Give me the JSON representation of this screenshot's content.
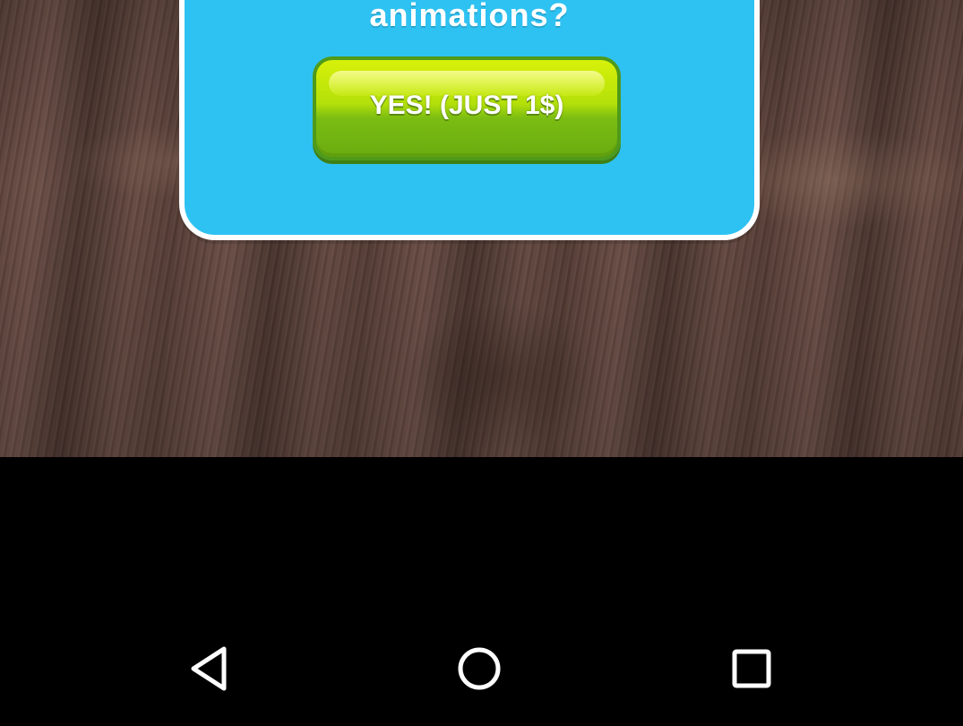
{
  "dialog": {
    "question_text": "animations?",
    "buy_button_label": "YES! (JUST 1$)"
  },
  "navbar": {
    "back_icon": "back-triangle-icon",
    "home_icon": "home-circle-icon",
    "recents_icon": "recents-square-icon"
  },
  "colors": {
    "dialog_background": "#2ec2f2",
    "dialog_border": "#ffffff",
    "button_green": "#8ccc12",
    "navbar_background": "#000000",
    "nav_icon": "#ffffff"
  }
}
